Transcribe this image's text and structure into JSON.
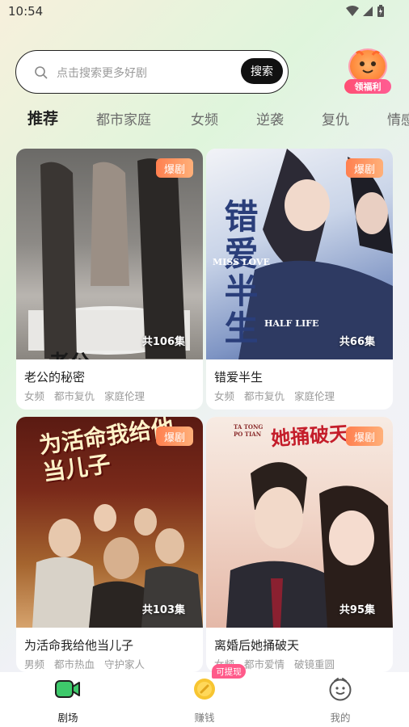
{
  "status_bar": {
    "time": "10:54"
  },
  "search": {
    "placeholder": "点击搜索更多好剧",
    "button_label": "搜索"
  },
  "reward": {
    "label": "领福利"
  },
  "tabs": [
    {
      "label": "推荐",
      "active": true
    },
    {
      "label": "都市家庭"
    },
    {
      "label": "女频"
    },
    {
      "label": "逆袭"
    },
    {
      "label": "复仇"
    },
    {
      "label": "情感"
    }
  ],
  "cards": [
    {
      "title": "老公的秘密",
      "badge": "爆剧",
      "episodes": "共106集",
      "tags": [
        "女频",
        "都市复仇",
        "家庭伦理"
      ],
      "poster_text": "老公"
    },
    {
      "title": "错爱半生",
      "badge": "爆剧",
      "episodes": "共66集",
      "tags": [
        "女频",
        "都市复仇",
        "家庭伦理"
      ],
      "poster_text": "错爱半生",
      "poster_en1": "MISS LOVE",
      "poster_en2": "HALF LIFE"
    },
    {
      "title": "为活命我给他当儿子",
      "badge": "爆剧",
      "episodes": "共103集",
      "tags": [
        "男频",
        "都市热血",
        "守护家人"
      ],
      "poster_text": "为活命我给他当儿子"
    },
    {
      "title": "离婚后她捅破天",
      "badge": "爆剧",
      "episodes": "共95集",
      "tags": [
        "女频",
        "都市爱情",
        "破镜重圆"
      ],
      "poster_text": "她捅破天",
      "poster_en1": "TA TONG PO TIAN"
    }
  ],
  "bottom_nav": [
    {
      "label": "剧场",
      "icon": "video-camera-icon",
      "active": true
    },
    {
      "label": "赚钱",
      "icon": "coin-icon",
      "tag": "可提现"
    },
    {
      "label": "我的",
      "icon": "smiley-face-icon"
    }
  ],
  "colors": {
    "accent": "#ff7f4f",
    "nav_active": "#3ec96b",
    "reward": "#ff4f74"
  }
}
